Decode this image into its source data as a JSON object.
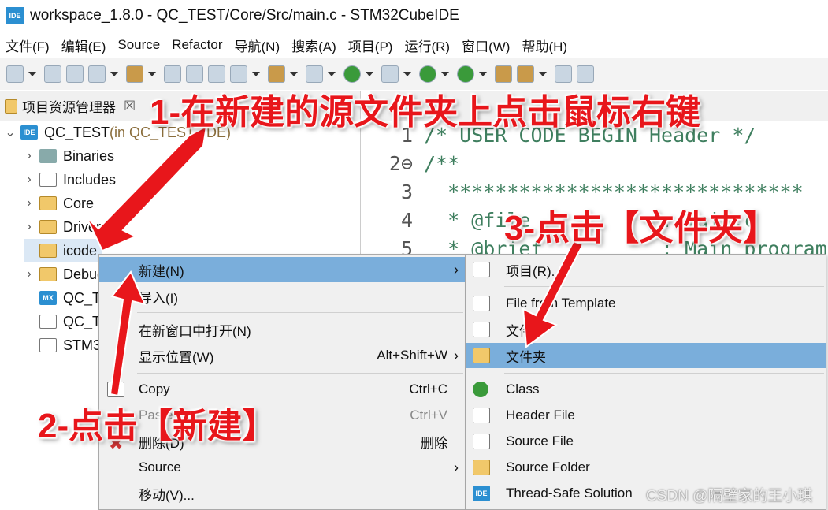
{
  "title": "workspace_1.8.0 - QC_TEST/Core/Src/main.c - STM32CubeIDE",
  "logo": "IDE",
  "menubar": [
    "文件(F)",
    "编辑(E)",
    "Source",
    "Refactor",
    "导航(N)",
    "搜索(A)",
    "项目(P)",
    "运行(R)",
    "窗口(W)",
    "帮助(H)"
  ],
  "panel": {
    "title": "项目资源管理器",
    "close": "☒",
    "tree": [
      {
        "label": "QC_TEST",
        "suffix": " (in QC_TEST_IDE)",
        "icon": "ide-project-icon",
        "expanded": true
      },
      {
        "label": "Binaries",
        "icon": "binaries-icon"
      },
      {
        "label": "Includes",
        "icon": "includes-icon"
      },
      {
        "label": "Core",
        "icon": "source-folder-icon"
      },
      {
        "label": "Drivers",
        "icon": "source-folder-icon"
      },
      {
        "label": "icode",
        "icon": "source-folder-icon"
      },
      {
        "label": "Debug",
        "icon": "folder-icon"
      },
      {
        "label": "QC_T",
        "icon": "mx-file-icon"
      },
      {
        "label": "QC_T",
        "icon": "file-icon"
      },
      {
        "label": "STM3",
        "icon": "ld-file-icon"
      }
    ]
  },
  "editor": {
    "lines": [
      {
        "n": "1",
        "t": "/* USER CODE BEGIN Header */"
      },
      {
        "n": "2⊖",
        "t": "/**"
      },
      {
        "n": "3",
        "t": "  ******************************"
      },
      {
        "n": "4",
        "t": "  * @file           : main.c"
      },
      {
        "n": "5",
        "t": "  * @brief          : Main program body"
      }
    ]
  },
  "context_menu": [
    {
      "label": "新建(N)",
      "arrow": "›",
      "highlight": true
    },
    {
      "label": "导入(I)"
    },
    {
      "label": "在新窗口中打开(N)"
    },
    {
      "label": "显示位置(W)",
      "shortcut": "Alt+Shift+W",
      "arrow": "›"
    },
    {
      "label": "Copy",
      "shortcut": "Ctrl+C",
      "icon": "copy-icon"
    },
    {
      "label": "Paste",
      "shortcut": "Ctrl+V",
      "icon": "paste-icon"
    },
    {
      "label": "删除(D)",
      "shortcut": "删除",
      "icon": "delete-icon"
    },
    {
      "label": "Source",
      "arrow": "›"
    },
    {
      "label": "移动(V)..."
    }
  ],
  "submenu": [
    {
      "label": "项目(R)...",
      "icon": "new-project-icon"
    },
    {
      "label": "File from Template",
      "icon": "new-file-icon"
    },
    {
      "label": "文件",
      "icon": "new-file-icon"
    },
    {
      "label": "文件夹",
      "icon": "new-folder-icon",
      "highlight": true
    },
    {
      "label": "Class",
      "icon": "new-class-icon"
    },
    {
      "label": "Header File",
      "icon": "header-file-icon"
    },
    {
      "label": "Source File",
      "icon": "source-file-icon"
    },
    {
      "label": "Source Folder",
      "icon": "source-folder-icon"
    },
    {
      "label": "Thread-Safe Solution",
      "icon": "ide-icon"
    }
  ],
  "annotations": {
    "step1": "1-在新建的源文件夹上点击鼠标右键",
    "step2": "2-点击【新建】",
    "step3": "3-点击【文件夹】",
    "color": "#e8161b"
  },
  "watermark": "CSDN @隔壁家的王小琪",
  "colors": {
    "highlight": "#7aaedb",
    "comment": "#3f7f5f"
  }
}
